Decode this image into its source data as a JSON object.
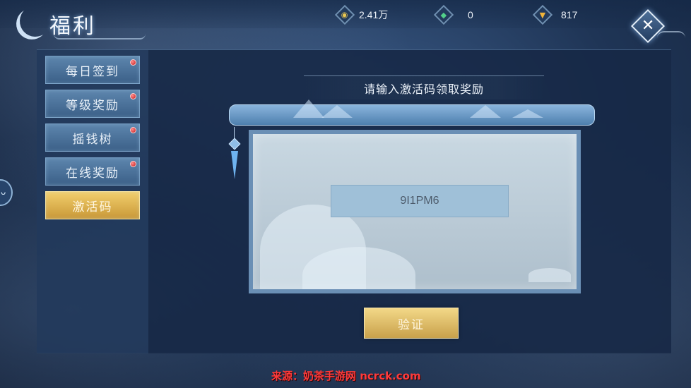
{
  "header": {
    "title": "福利",
    "currencies": [
      {
        "icon": "coin-icon",
        "value": "2.41万"
      },
      {
        "icon": "jade-icon",
        "value": "0"
      },
      {
        "icon": "ingot-icon",
        "value": "817"
      }
    ],
    "close_icon": "close-icon"
  },
  "sidebar": {
    "items": [
      {
        "label": "每日签到",
        "badge": true,
        "active": false
      },
      {
        "label": "等级奖励",
        "badge": true,
        "active": false
      },
      {
        "label": "摇钱树",
        "badge": true,
        "active": false
      },
      {
        "label": "在线奖励",
        "badge": true,
        "active": false
      },
      {
        "label": "激活码",
        "badge": false,
        "active": true
      }
    ]
  },
  "main": {
    "prompt": "请输入激活码领取奖励",
    "code_value": "9I1PM6",
    "verify_label": "验证"
  },
  "watermark": "来源：奶茶手游网 ncrck.com",
  "colors": {
    "active_tab": "#e2b653",
    "inactive_tab": "#4c739b",
    "badge_red": "#d42525",
    "watermark_red": "#ff3a3a"
  }
}
